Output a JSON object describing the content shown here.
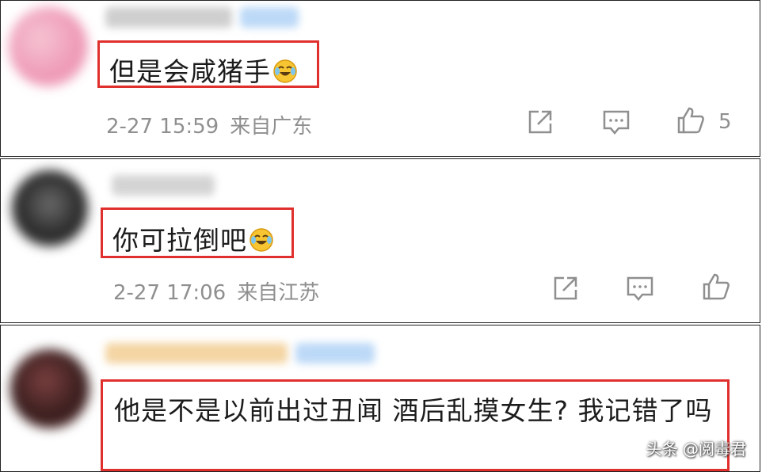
{
  "comments": [
    {
      "text": "但是会咸猪手",
      "date": "2-27 15:59",
      "location": "来自广东",
      "likes": "5"
    },
    {
      "text": "你可拉倒吧",
      "date": "2-27 17:06",
      "location": "来自江苏"
    },
    {
      "text": "他是不是以前出过丑闻 酒后乱摸女生? 我记错了吗"
    }
  ],
  "watermark": "头条 @阅毒君",
  "colors": {
    "highlight_border": "#e0302d",
    "meta_text": "#8f8f8f"
  },
  "icons": [
    "share-icon",
    "reply-icon",
    "like-icon",
    "laughing-emoji-icon"
  ]
}
